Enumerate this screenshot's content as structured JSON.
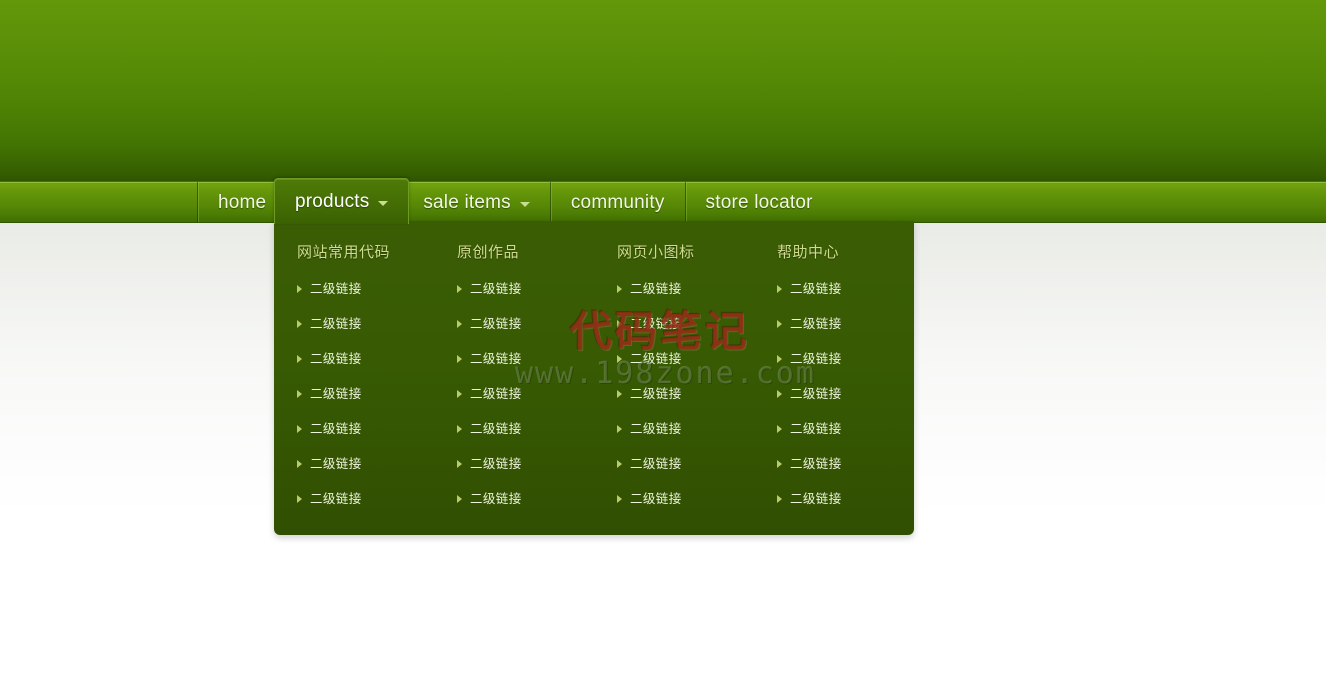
{
  "site": {
    "background_top_color": "#63980a",
    "background_bottom_color": "#2f5500",
    "nav_bar_color": "#6e9f0f",
    "dropdown_panel_color": "#375a03",
    "accent_color": "#cfdc90",
    "link_color": "#eef4de",
    "bullet_color": "#b9cc6a"
  },
  "nav": {
    "items": [
      {
        "label": "home",
        "has_caret": false,
        "active": false
      },
      {
        "label": "products",
        "has_caret": true,
        "active": true
      },
      {
        "label": "sale items",
        "has_caret": true,
        "active": false
      },
      {
        "label": "community",
        "has_caret": false,
        "active": false
      },
      {
        "label": "store locator",
        "has_caret": false,
        "active": false
      }
    ]
  },
  "dropdown": {
    "open_for": "products",
    "columns": [
      {
        "title": "网站常用代码",
        "links": [
          "二级链接",
          "二级链接",
          "二级链接",
          "二级链接",
          "二级链接",
          "二级链接",
          "二级链接"
        ]
      },
      {
        "title": "原创作品",
        "links": [
          "二级链接",
          "二级链接",
          "二级链接",
          "二级链接",
          "二级链接",
          "二级链接",
          "二级链接"
        ]
      },
      {
        "title": "网页小图标",
        "links": [
          "二级链接",
          "二级链接",
          "二级链接",
          "二级链接",
          "二级链接",
          "二级链接",
          "二级链接"
        ]
      },
      {
        "title": "帮助中心",
        "links": [
          "二级链接",
          "二级链接",
          "二级链接",
          "二级链接",
          "二级链接",
          "二级链接",
          "二级链接"
        ]
      }
    ]
  },
  "watermark": {
    "brand": "代码笔记",
    "url": "www.198zone.com",
    "brand_color": "#962a14",
    "url_color": "#afbea0"
  }
}
